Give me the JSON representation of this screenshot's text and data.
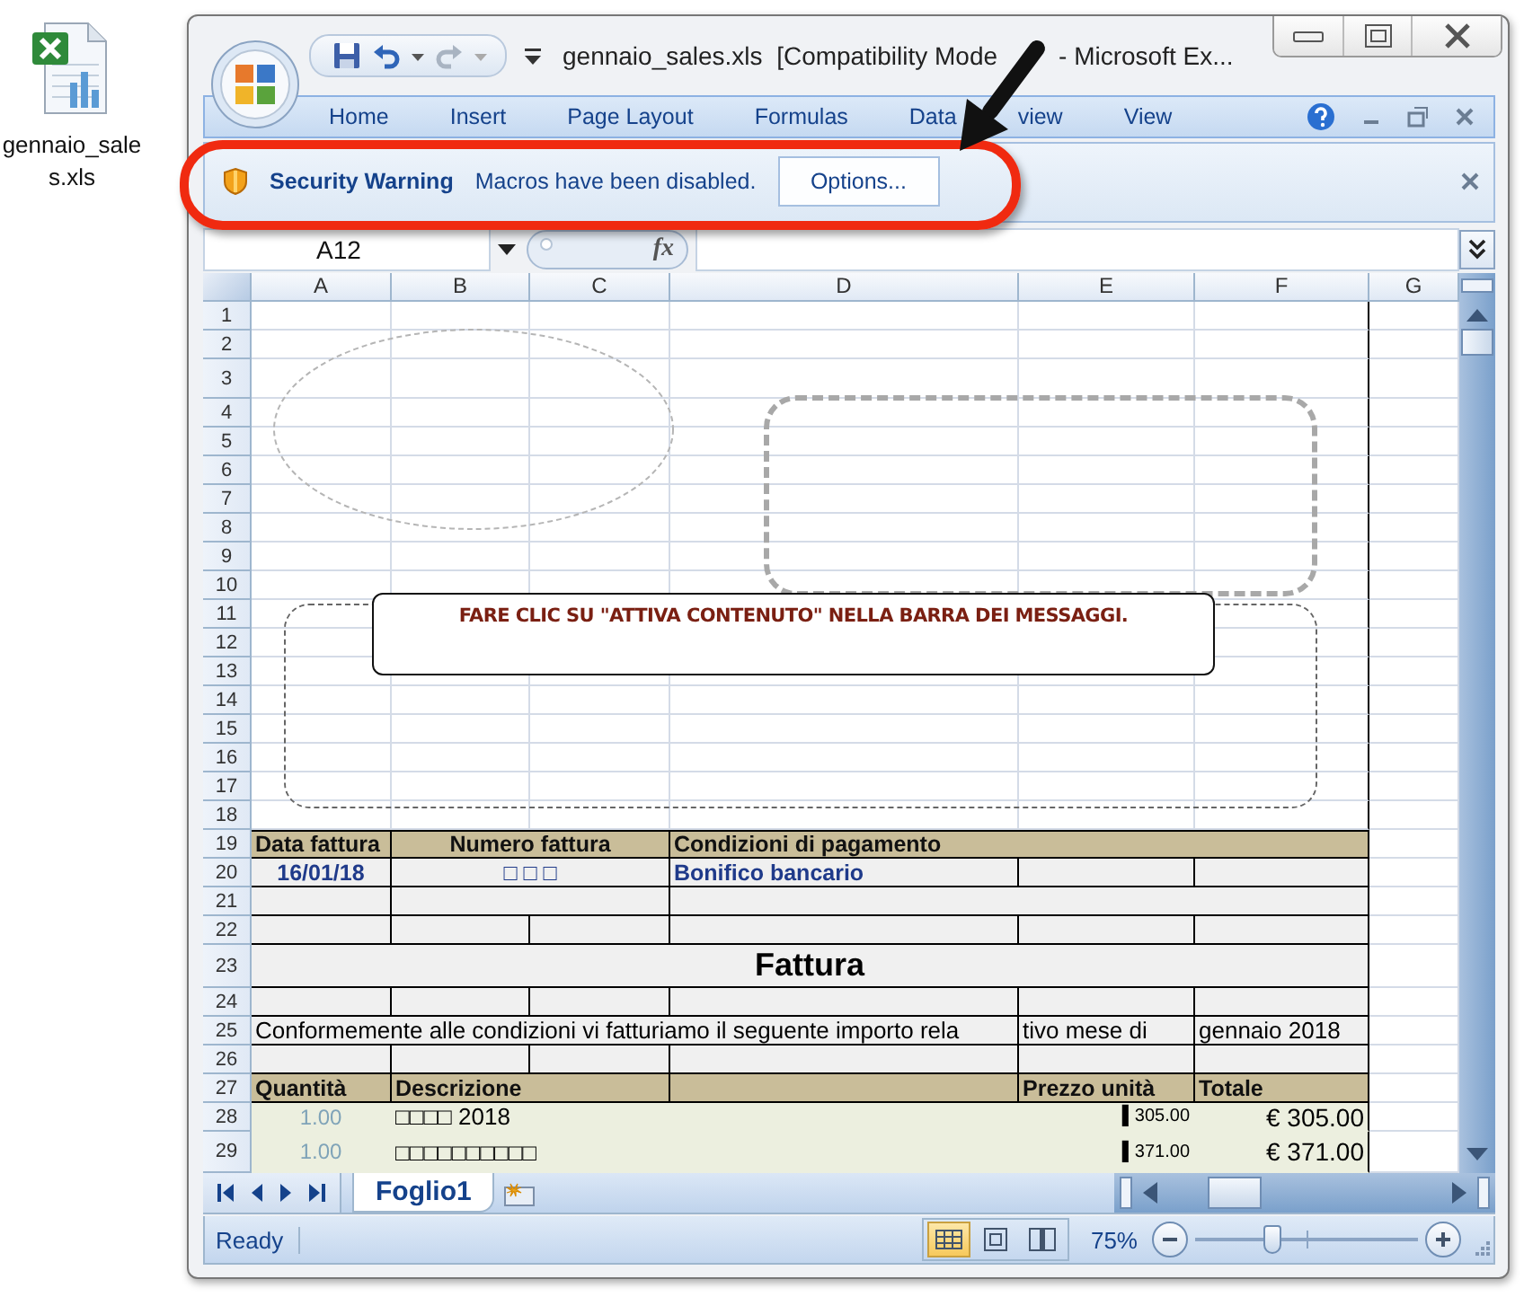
{
  "desktop_icon": {
    "label": "gennaio_sales.xls"
  },
  "window": {
    "title": "gennaio_sales.xls  [Compatibility Mode",
    "title_tail": "- Microsoft Ex..."
  },
  "ribbon_tabs": [
    "Home",
    "Insert",
    "Page Layout",
    "Formulas",
    "Data",
    "view",
    "View"
  ],
  "security_bar": {
    "title": "Security Warning",
    "message": "Macros have been disabled.",
    "button": "Options..."
  },
  "formula_bar": {
    "name_box": "A12",
    "function_label": "fx"
  },
  "sheet": {
    "columns": [
      "A",
      "B",
      "C",
      "D",
      "E",
      "F",
      "G"
    ],
    "rows": [
      {
        "header": "1"
      },
      {
        "header": "2"
      },
      {
        "header": "3"
      },
      {
        "header": "4"
      },
      {
        "header": "5"
      },
      {
        "header": "6"
      },
      {
        "header": "7"
      },
      {
        "header": "8"
      },
      {
        "header": "9"
      },
      {
        "header": "10"
      },
      {
        "header": "11"
      },
      {
        "header": "12"
      },
      {
        "header": "13"
      },
      {
        "header": "14"
      },
      {
        "header": "15"
      },
      {
        "header": "16"
      },
      {
        "header": "17"
      },
      {
        "header": "18"
      },
      {
        "header": "19",
        "cells": [
          {
            "kind": "label",
            "text": "Data fattura"
          },
          {
            "kind": "label_center",
            "text": "Numero fattura"
          },
          {
            "kind": "merged"
          },
          {
            "kind": "label",
            "text": "Condizioni di pagamento"
          },
          {
            "kind": "merged"
          },
          {
            "kind": "merged"
          }
        ]
      },
      {
        "header": "20",
        "cells": [
          {
            "kind": "value_center",
            "text": "16/01/18"
          },
          {
            "kind": "value_center",
            "text": "□ □ □"
          },
          {
            "kind": "merged"
          },
          {
            "kind": "value",
            "text": "Bonifico bancario"
          },
          {
            "kind": "blank"
          },
          {
            "kind": "blank"
          }
        ]
      },
      {
        "header": "21",
        "cells": [
          {
            "kind": "blank"
          },
          {
            "kind": "blank"
          },
          {
            "kind": "merged"
          },
          {
            "kind": "blank"
          },
          {
            "kind": "merged"
          },
          {
            "kind": "merged"
          }
        ]
      },
      {
        "header": "22",
        "cells": [
          {
            "kind": "blank"
          },
          {
            "kind": "blank"
          },
          {
            "kind": "blank"
          },
          {
            "kind": "blank"
          },
          {
            "kind": "blank"
          },
          {
            "kind": "blank"
          }
        ]
      },
      {
        "header": "23",
        "cells": [
          {
            "kind": "title",
            "text": "Fattura"
          },
          {
            "kind": "merged"
          },
          {
            "kind": "merged"
          },
          {
            "kind": "merged"
          },
          {
            "kind": "merged"
          },
          {
            "kind": "merged"
          }
        ]
      },
      {
        "header": "24",
        "cells": [
          {
            "kind": "blank"
          },
          {
            "kind": "blank"
          },
          {
            "kind": "blank"
          },
          {
            "kind": "blank"
          },
          {
            "kind": "blank"
          },
          {
            "kind": "blank"
          }
        ]
      },
      {
        "header": "25",
        "cells": [
          {
            "kind": "text",
            "text": "Conformemente alle condizioni vi fatturiamo il seguente importo rela"
          },
          {
            "kind": "merged"
          },
          {
            "kind": "merged"
          },
          {
            "kind": "merged"
          },
          {
            "kind": "text",
            "text": "tivo mese di"
          },
          {
            "kind": "text",
            "text": "gennaio 2018"
          }
        ]
      },
      {
        "header": "26",
        "cells": [
          {
            "kind": "blank"
          },
          {
            "kind": "blank"
          },
          {
            "kind": "blank"
          },
          {
            "kind": "blank"
          },
          {
            "kind": "blank"
          },
          {
            "kind": "blank"
          }
        ]
      },
      {
        "header": "27",
        "cells": [
          {
            "kind": "label",
            "text": "Quantità"
          },
          {
            "kind": "label",
            "text": "Descrizione"
          },
          {
            "kind": "merged"
          },
          {
            "kind": "label_empty"
          },
          {
            "kind": "label",
            "text": "Prezzo unità"
          },
          {
            "kind": "label",
            "text": "Totale"
          }
        ]
      },
      {
        "header": "28",
        "cells": [
          {
            "kind": "faint",
            "text": "1.00"
          },
          {
            "kind": "item",
            "text": "□□□□ 2018"
          },
          {
            "kind": "merged"
          },
          {
            "kind": "merged"
          },
          {
            "kind": "small",
            "text": "▌305.00"
          },
          {
            "kind": "money",
            "text": "€ 305.00"
          }
        ]
      },
      {
        "header": "29",
        "cells": [
          {
            "kind": "faint",
            "text": "1.00"
          },
          {
            "kind": "item",
            "text": "□□□□□□□□□□"
          },
          {
            "kind": "merged"
          },
          {
            "kind": "merged"
          },
          {
            "kind": "small",
            "text": "▌371.00"
          },
          {
            "kind": "money",
            "text": "€ 371.00"
          }
        ]
      }
    ]
  },
  "shapes": [
    {
      "kind": "ellipse"
    },
    {
      "kind": "dotted_box"
    },
    {
      "kind": "dashed_box"
    },
    {
      "kind": "callout",
      "text": "FARE CLIC SU \"ATTIVA CONTENUTO\" NELLA BARRA DEI MESSAGGI."
    }
  ],
  "sheet_tabs": [
    {
      "label": "Foglio1",
      "selected": true
    }
  ],
  "status_bar": {
    "status": "Ready",
    "views": [
      {
        "kind": "normal",
        "selected": true
      },
      {
        "kind": "page_layout",
        "selected": false
      },
      {
        "kind": "page_break",
        "selected": false
      }
    ],
    "zoom": "75%",
    "zoom_slider": {
      "level": 0.35
    }
  }
}
